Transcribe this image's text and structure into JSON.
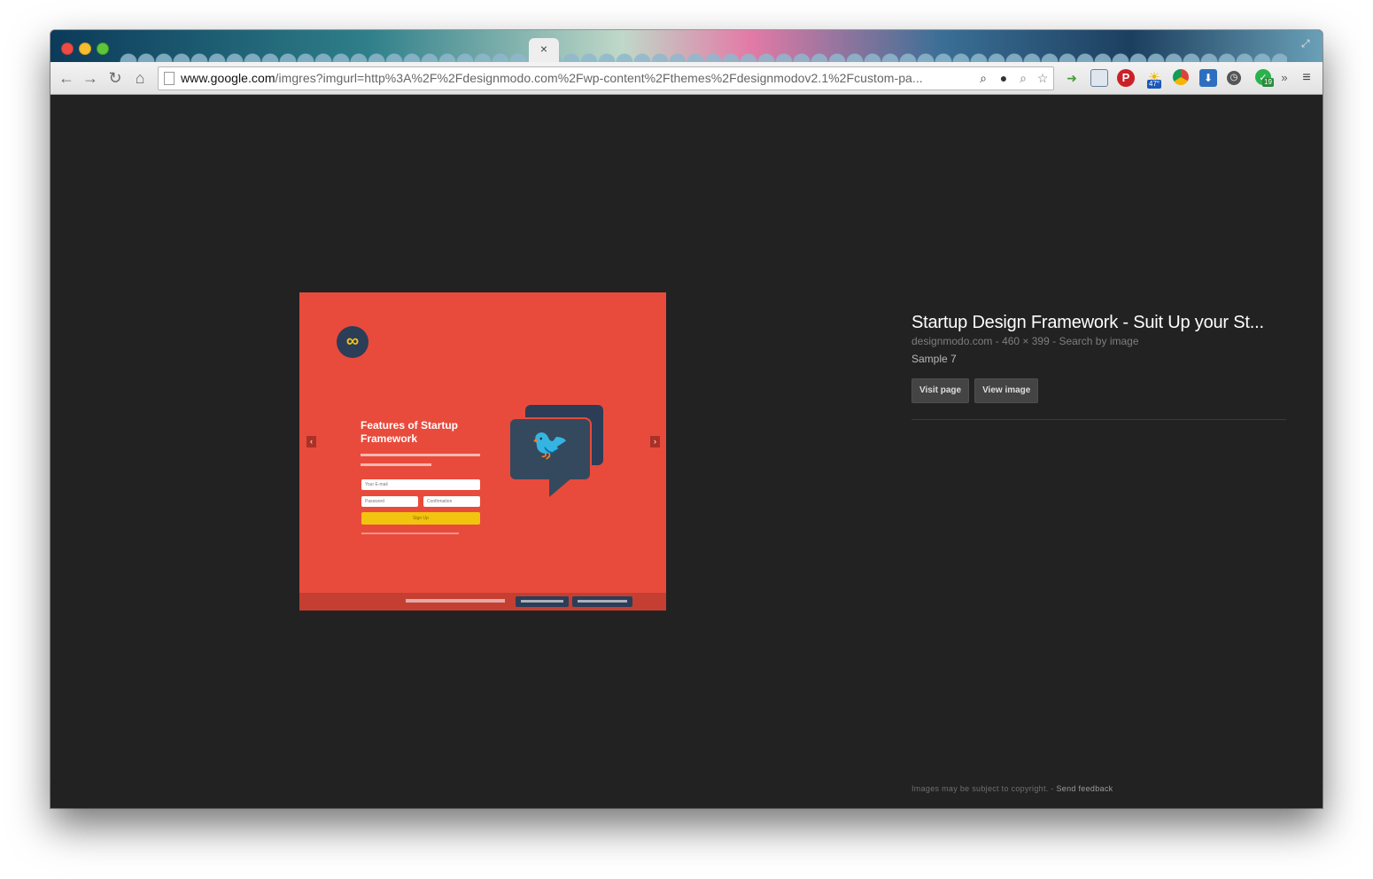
{
  "browser": {
    "url_host": "www.google.com",
    "url_path": "/imgres?imgurl=http%3A%2F%2Fdesignmodo.com%2Fwp-content%2Fthemes%2Fdesignmodov2.1%2Fcustom-pa...",
    "tab_close_glyph": "×",
    "nav_icons": [
      "back-arrow-icon",
      "forward-arrow-icon",
      "reload-icon",
      "home-icon"
    ],
    "extension_icons": [
      "page-zoom-icon",
      "lightbulb-icon",
      "magnifier-icon",
      "bookmark-star-icon",
      "extension-arrow-icon",
      "extension-window-icon",
      "pinterest-icon",
      "weather-icon",
      "chrome-color-icon",
      "download-icon",
      "clock-icon",
      "evernote-icon",
      "overflow-chevron-icon",
      "menu-icon"
    ],
    "weather_badge": "47°",
    "evernote_badge": "19",
    "overflow_label": "»"
  },
  "preview": {
    "title": "Features of Startup Framework",
    "email_placeholder": "Your E-mail",
    "password_placeholder": "Password",
    "confirmation_placeholder": "Confirmation",
    "signup_label": "Sign Up",
    "prev_glyph": "‹",
    "next_glyph": "›",
    "logo_glyph": "∞",
    "bird_glyph": "🐦",
    "brand_color": "#e84b3c",
    "accent_color": "#f1c40f",
    "dark_color": "#34495e"
  },
  "info": {
    "title": "Startup Design Framework - Suit Up your St...",
    "source": "designmodo.com",
    "separator1": " - ",
    "dimensions": "460 × 399",
    "separator2": " - ",
    "search_by_image": "Search by image",
    "description": "Sample 7",
    "visit_page_label": "Visit page",
    "view_image_label": "View image"
  },
  "footer": {
    "copyright_text": "Images may be subject to copyright.",
    "separator": " - ",
    "feedback_label": "Send feedback"
  }
}
